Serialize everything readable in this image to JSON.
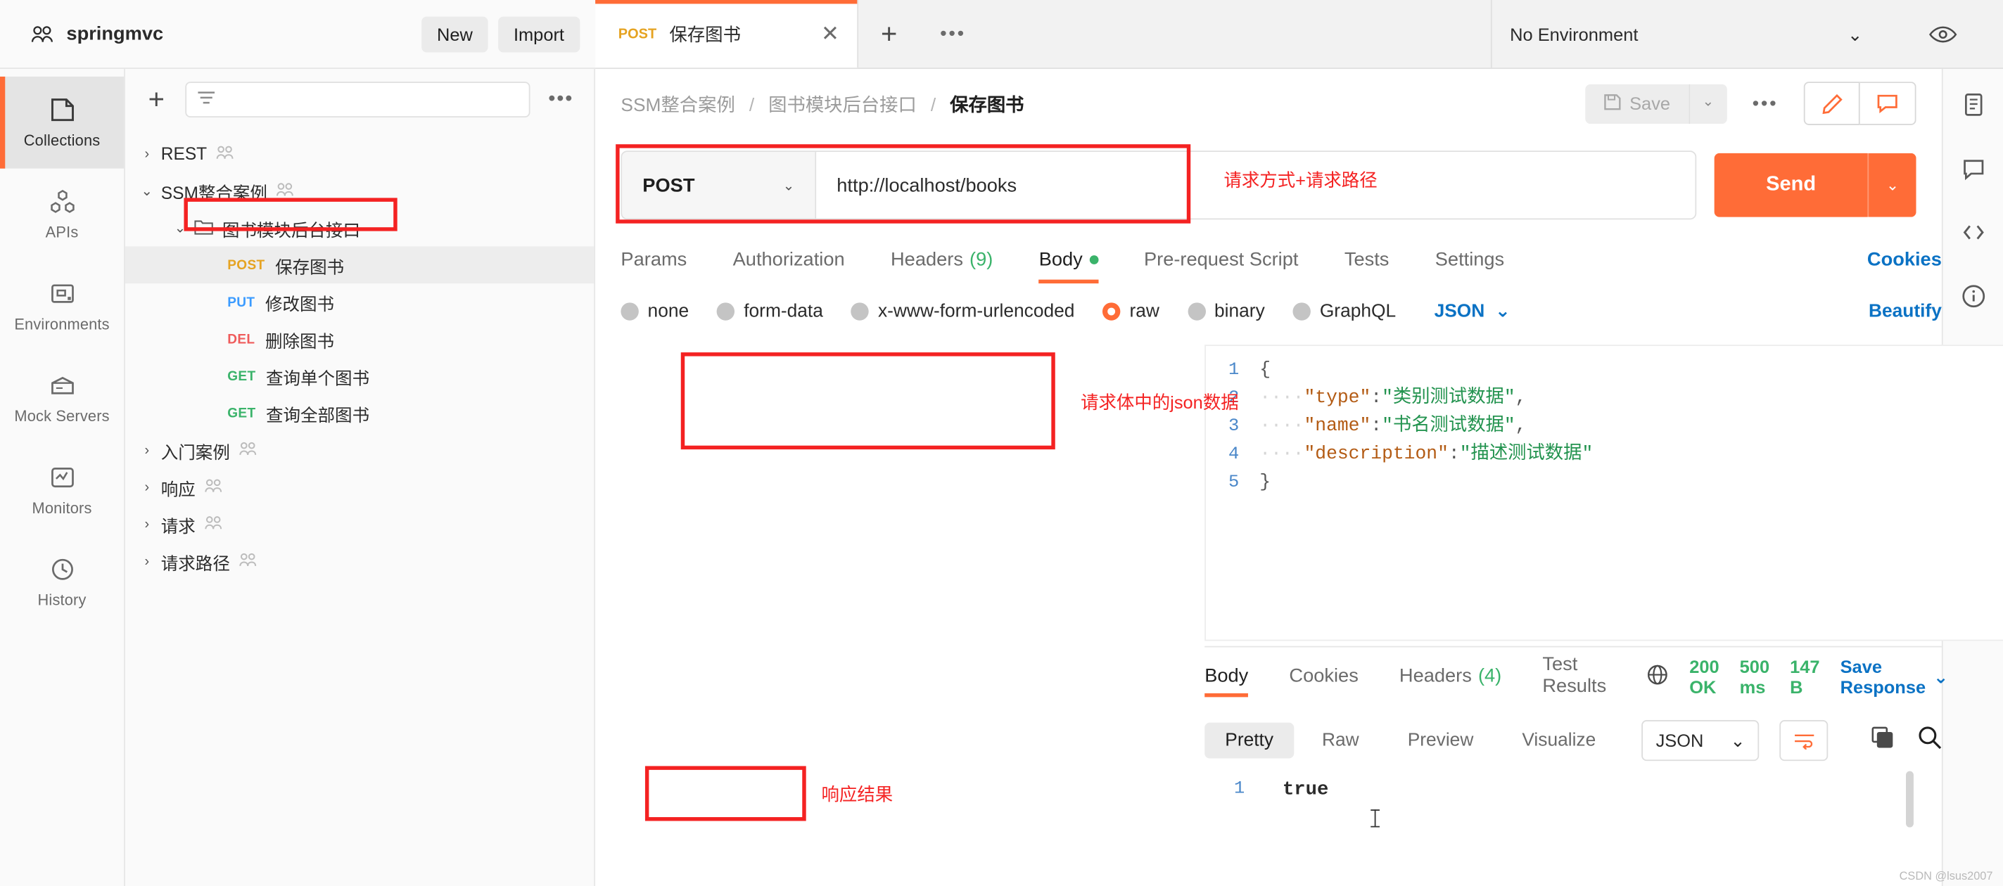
{
  "workspace": {
    "name": "springmvc",
    "icon": "users-icon"
  },
  "topbar": {
    "new_label": "New",
    "import_label": "Import"
  },
  "rail": {
    "items": [
      {
        "label": "Collections",
        "icon": "collections-icon",
        "active": true
      },
      {
        "label": "APIs",
        "icon": "apis-icon",
        "active": false
      },
      {
        "label": "Environments",
        "icon": "environments-icon",
        "active": false
      },
      {
        "label": "Mock Servers",
        "icon": "mock-servers-icon",
        "active": false
      },
      {
        "label": "Monitors",
        "icon": "monitors-icon",
        "active": false
      },
      {
        "label": "History",
        "icon": "history-icon",
        "active": false
      }
    ]
  },
  "sidebar": {
    "add_label": "+",
    "filter_placeholder": "",
    "more_label": "•••",
    "tree": [
      {
        "indent": 0,
        "chevron": "›",
        "label": "REST",
        "shared": true,
        "type": "collection"
      },
      {
        "indent": 0,
        "chevron": "⌄",
        "label": "SSM整合案例",
        "shared": true,
        "type": "collection"
      },
      {
        "indent": 1,
        "chevron": "⌄",
        "label": "图书模块后台接口",
        "shared": false,
        "type": "folder"
      },
      {
        "indent": 2,
        "chevron": "",
        "method": "POST",
        "label": "保存图书",
        "type": "request",
        "selected": true,
        "annotated": true
      },
      {
        "indent": 2,
        "chevron": "",
        "method": "PUT",
        "label": "修改图书",
        "type": "request"
      },
      {
        "indent": 2,
        "chevron": "",
        "method": "DEL",
        "label": "删除图书",
        "type": "request"
      },
      {
        "indent": 2,
        "chevron": "",
        "method": "GET",
        "label": "查询单个图书",
        "type": "request"
      },
      {
        "indent": 2,
        "chevron": "",
        "method": "GET",
        "label": "查询全部图书",
        "type": "request"
      },
      {
        "indent": 0,
        "chevron": "›",
        "label": "入门案例",
        "shared": true,
        "type": "collection"
      },
      {
        "indent": 0,
        "chevron": "›",
        "label": "响应",
        "shared": true,
        "type": "collection"
      },
      {
        "indent": 0,
        "chevron": "›",
        "label": "请求",
        "shared": true,
        "type": "collection"
      },
      {
        "indent": 0,
        "chevron": "›",
        "label": "请求路径",
        "shared": true,
        "type": "collection"
      }
    ]
  },
  "tabs": {
    "open": [
      {
        "method": "POST",
        "name": "保存图书",
        "close": "✕",
        "active": true
      }
    ],
    "add_label": "+",
    "more_label": "•••"
  },
  "environment": {
    "selected": "No Environment",
    "caret": "⌄"
  },
  "breadcrumb": {
    "parts": [
      "SSM整合案例",
      "图书模块后台接口"
    ],
    "current": "保存图书",
    "separator": "/"
  },
  "actions": {
    "save_label": "Save",
    "save_caret": "⌄",
    "more": "•••"
  },
  "request": {
    "method": "POST",
    "method_caret": "⌄",
    "url": "http://localhost/books",
    "send_label": "Send",
    "send_caret": "⌄",
    "tabs": [
      {
        "label": "Params",
        "active": false
      },
      {
        "label": "Authorization",
        "active": false
      },
      {
        "label": "Headers",
        "count": "(9)",
        "active": false
      },
      {
        "label": "Body",
        "dot": true,
        "active": true
      },
      {
        "label": "Pre-request Script",
        "active": false
      },
      {
        "label": "Tests",
        "active": false
      },
      {
        "label": "Settings",
        "active": false
      }
    ],
    "cookies_label": "Cookies",
    "body_types": [
      {
        "label": "none",
        "selected": false
      },
      {
        "label": "form-data",
        "selected": false
      },
      {
        "label": "x-www-form-urlencoded",
        "selected": false
      },
      {
        "label": "raw",
        "selected": true
      },
      {
        "label": "binary",
        "selected": false
      },
      {
        "label": "GraphQL",
        "selected": false
      }
    ],
    "raw_format": "JSON",
    "raw_format_caret": "⌄",
    "beautify_label": "Beautify",
    "body_lines": [
      {
        "n": "1",
        "segments": [
          {
            "t": "{",
            "c": "cp"
          }
        ]
      },
      {
        "n": "2",
        "segments": [
          {
            "t": "····",
            "c": "cdot"
          },
          {
            "t": "\"type\"",
            "c": "ck"
          },
          {
            "t": ":",
            "c": "cp"
          },
          {
            "t": "\"类别测试数据\"",
            "c": "cv"
          },
          {
            "t": ",",
            "c": "cp"
          }
        ]
      },
      {
        "n": "3",
        "segments": [
          {
            "t": "····",
            "c": "cdot"
          },
          {
            "t": "\"name\"",
            "c": "ck"
          },
          {
            "t": ":",
            "c": "cp"
          },
          {
            "t": "\"书名测试数据\"",
            "c": "cv"
          },
          {
            "t": ",",
            "c": "cp"
          }
        ]
      },
      {
        "n": "4",
        "segments": [
          {
            "t": "····",
            "c": "cdot"
          },
          {
            "t": "\"description\"",
            "c": "ck"
          },
          {
            "t": ":",
            "c": "cp"
          },
          {
            "t": "\"描述测试数据\"",
            "c": "cv"
          }
        ]
      },
      {
        "n": "5",
        "segments": [
          {
            "t": "}",
            "c": "cp"
          }
        ]
      }
    ]
  },
  "response": {
    "tabs": [
      {
        "label": "Body",
        "active": true
      },
      {
        "label": "Cookies",
        "active": false
      },
      {
        "label": "Headers",
        "count": "(4)",
        "active": false
      },
      {
        "label": "Test Results",
        "active": false
      }
    ],
    "status": "200 OK",
    "time": "500 ms",
    "size": "147 B",
    "save_response_label": "Save Response",
    "save_response_caret": "⌄",
    "format_buttons": [
      {
        "label": "Pretty",
        "active": true
      },
      {
        "label": "Raw",
        "active": false
      },
      {
        "label": "Preview",
        "active": false
      },
      {
        "label": "Visualize",
        "active": false
      }
    ],
    "format_type": "JSON",
    "format_caret": "⌄",
    "body_line_number": "1",
    "body_value": "true"
  },
  "annotations": [
    {
      "id": "sidebar-request",
      "text": ""
    },
    {
      "id": "url-bar",
      "text": "请求方式+请求路径"
    },
    {
      "id": "json-body",
      "text": "请求体中的json数据"
    },
    {
      "id": "response-result",
      "text": "响应结果"
    }
  ],
  "watermark": "CSDN @lsus2007",
  "colors": {
    "accent": "#ff6c37",
    "annotation": "#f42222",
    "link": "#0b72c4",
    "success": "#3ab36a"
  }
}
